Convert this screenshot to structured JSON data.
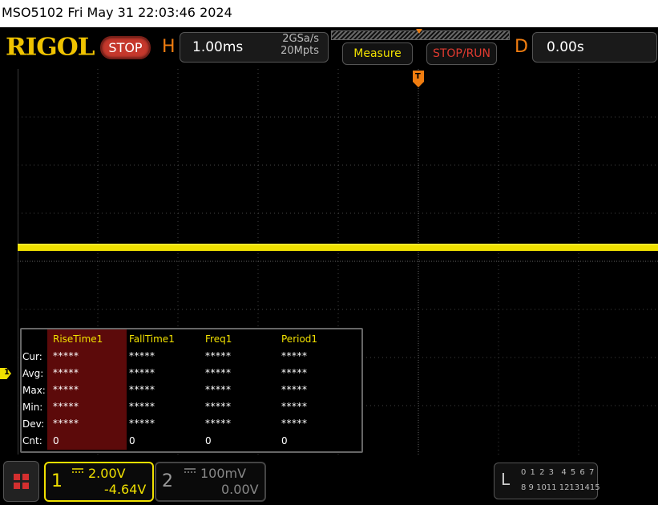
{
  "header": {
    "title": "MSO5102  Fri May 31 22:03:46 2024"
  },
  "toolbar": {
    "brand": "RIGOL",
    "run_state": "STOP",
    "horizontal": {
      "label": "H",
      "timebase": "1.00ms",
      "sample_rate": "2GSa/s",
      "memory_depth": "20Mpts"
    },
    "measure_label": "Measure",
    "stop_run_label": "STOP/RUN",
    "delay": {
      "label": "D",
      "value": "0.00s"
    }
  },
  "trigger": {
    "marker_label": "T"
  },
  "measurements": {
    "headers": [
      "RiseTime1",
      "FallTime1",
      "Freq1",
      "Period1"
    ],
    "rows": [
      {
        "label": "Cur:",
        "values": [
          "*****",
          "*****",
          "*****",
          "*****"
        ]
      },
      {
        "label": "Avg:",
        "values": [
          "*****",
          "*****",
          "*****",
          "*****"
        ]
      },
      {
        "label": "Max:",
        "values": [
          "*****",
          "*****",
          "*****",
          "*****"
        ]
      },
      {
        "label": "Min:",
        "values": [
          "*****",
          "*****",
          "*****",
          "*****"
        ]
      },
      {
        "label": "Dev:",
        "values": [
          "*****",
          "*****",
          "*****",
          "*****"
        ]
      },
      {
        "label": "Cnt:",
        "values": [
          "0",
          "0",
          "0",
          "0"
        ]
      }
    ]
  },
  "channels": {
    "ch1": {
      "number": "1",
      "scale": "2.00V",
      "offset": "-4.64V",
      "marker_label": "1",
      "color": "#f0e000"
    },
    "ch2": {
      "number": "2",
      "scale": "100mV",
      "offset": "0.00V",
      "color": "#888888"
    }
  },
  "logic": {
    "label": "L",
    "row1": "0 1 2 3  4 5 6 7",
    "row2": "8 9 1011 12131415"
  },
  "colors": {
    "brand": "#f0c300",
    "accent_orange": "#f07d10",
    "stop_red": "#c5382c",
    "measure_highlight": "#5c0a0a"
  }
}
